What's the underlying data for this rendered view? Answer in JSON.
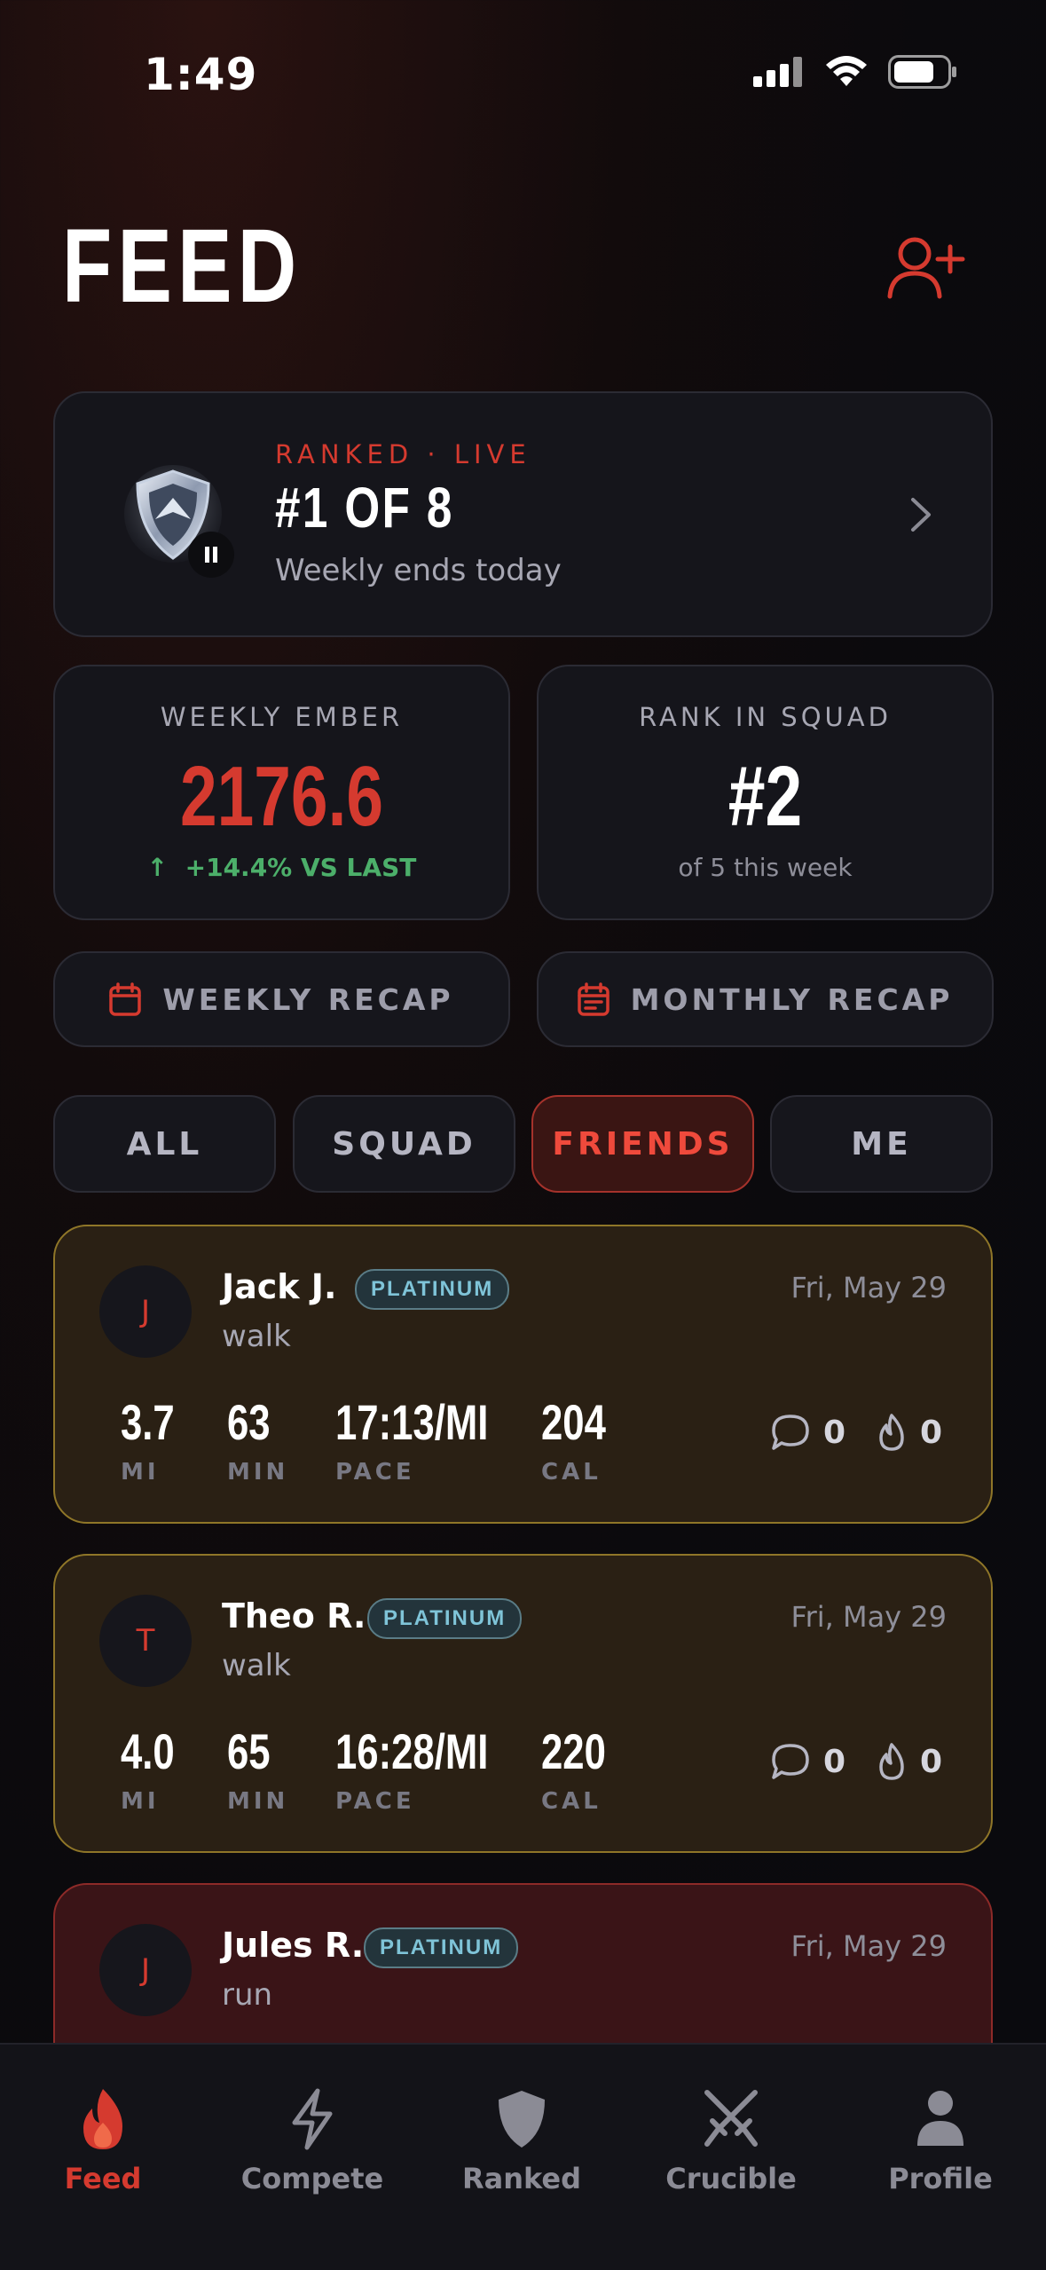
{
  "status": {
    "time": "1:49"
  },
  "header": {
    "title": "FEED"
  },
  "ranked": {
    "label": "RANKED · LIVE",
    "position": "#1 OF 8",
    "subtitle": "Weekly ends today"
  },
  "stats": {
    "weekly_ember": {
      "label": "WEEKLY EMBER",
      "value": "2176.6",
      "change": "+14.4% VS LAST"
    },
    "rank": {
      "label": "RANK IN SQUAD",
      "value": "#2",
      "sub": "of 5 this week"
    }
  },
  "recap": {
    "weekly": "WEEKLY RECAP",
    "monthly": "MONTHLY RECAP"
  },
  "filters": [
    "ALL",
    "SQUAD",
    "FRIENDS",
    "ME"
  ],
  "active_filter": "FRIENDS",
  "feed": [
    {
      "initial": "J",
      "name": "Jack J.",
      "badge": "PLATINUM",
      "date": "Fri, May 29",
      "activity": "walk",
      "metrics": [
        {
          "value": "3.7",
          "label": "MI"
        },
        {
          "value": "63",
          "label": "MIN"
        },
        {
          "value": "17:13/MI",
          "label": "PACE"
        },
        {
          "value": "204",
          "label": "CAL"
        }
      ],
      "comments": "0",
      "fires": "0"
    },
    {
      "initial": "T",
      "name": "Theo R.",
      "badge": "PLATINUM",
      "date": "Fri, May 29",
      "activity": "walk",
      "metrics": [
        {
          "value": "4.0",
          "label": "MI"
        },
        {
          "value": "65",
          "label": "MIN"
        },
        {
          "value": "16:28/MI",
          "label": "PACE"
        },
        {
          "value": "220",
          "label": "CAL"
        }
      ],
      "comments": "0",
      "fires": "0"
    },
    {
      "initial": "J",
      "name": "Jules R.",
      "badge": "PLATINUM",
      "date": "Fri, May 29",
      "activity": "run"
    }
  ],
  "tabbar": [
    {
      "label": "Feed",
      "icon": "flame-icon",
      "active": true
    },
    {
      "label": "Compete",
      "icon": "bolt-icon",
      "active": false
    },
    {
      "label": "Ranked",
      "icon": "shield-icon",
      "active": false
    },
    {
      "label": "Crucible",
      "icon": "crossed-swords-icon",
      "active": false
    },
    {
      "label": "Profile",
      "icon": "person-icon",
      "active": false
    }
  ],
  "colors": {
    "accent": "#d53a2f",
    "positive": "#4caf6a",
    "platinum": "#7fc4d8",
    "gold_border": "#8f7628"
  }
}
